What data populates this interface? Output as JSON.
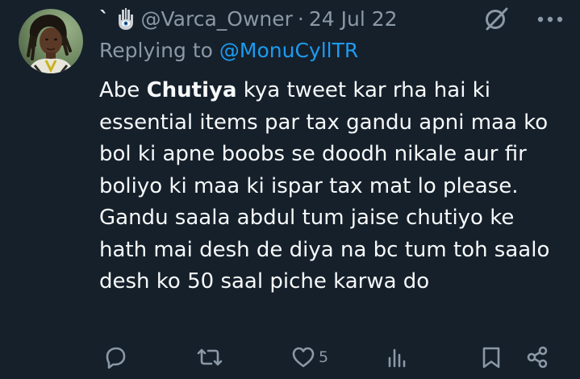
{
  "tweet": {
    "display_name": "`",
    "handle": "@Varca_Owner",
    "separator": "·",
    "date": "24 Jul 22",
    "replying_prefix": "Replying to",
    "replying_to": "@MonuCyllTR",
    "body": [
      {
        "text": "Abe ",
        "bold": false
      },
      {
        "text": "Chutiya",
        "bold": true
      },
      {
        "text": " kya tweet kar rha hai ki essential items par tax gandu apni maa ko bol ki apne boobs se doodh nikale aur fir boliyo ki maa ki ispar tax mat lo please. Gandu saala abdul tum jaise chutiyo ke hath mai desh de diya na bc tum toh saalo desh ko 50 saal piche karwa do",
        "bold": false
      }
    ],
    "likes": "5"
  },
  "icons": {
    "avatar": "profile-photo",
    "name_emoji": "hamsa-icon",
    "grok": "grok-icon",
    "more": "more-icon",
    "reply": "reply-icon",
    "retweet": "retweet-icon",
    "like": "heart-icon",
    "views": "views-icon",
    "bookmark": "bookmark-icon",
    "share": "share-icon"
  },
  "colors": {
    "background": "#15202b",
    "text": "#f7f9f9",
    "secondary": "#8b98a5",
    "link": "#1d9bf0"
  }
}
